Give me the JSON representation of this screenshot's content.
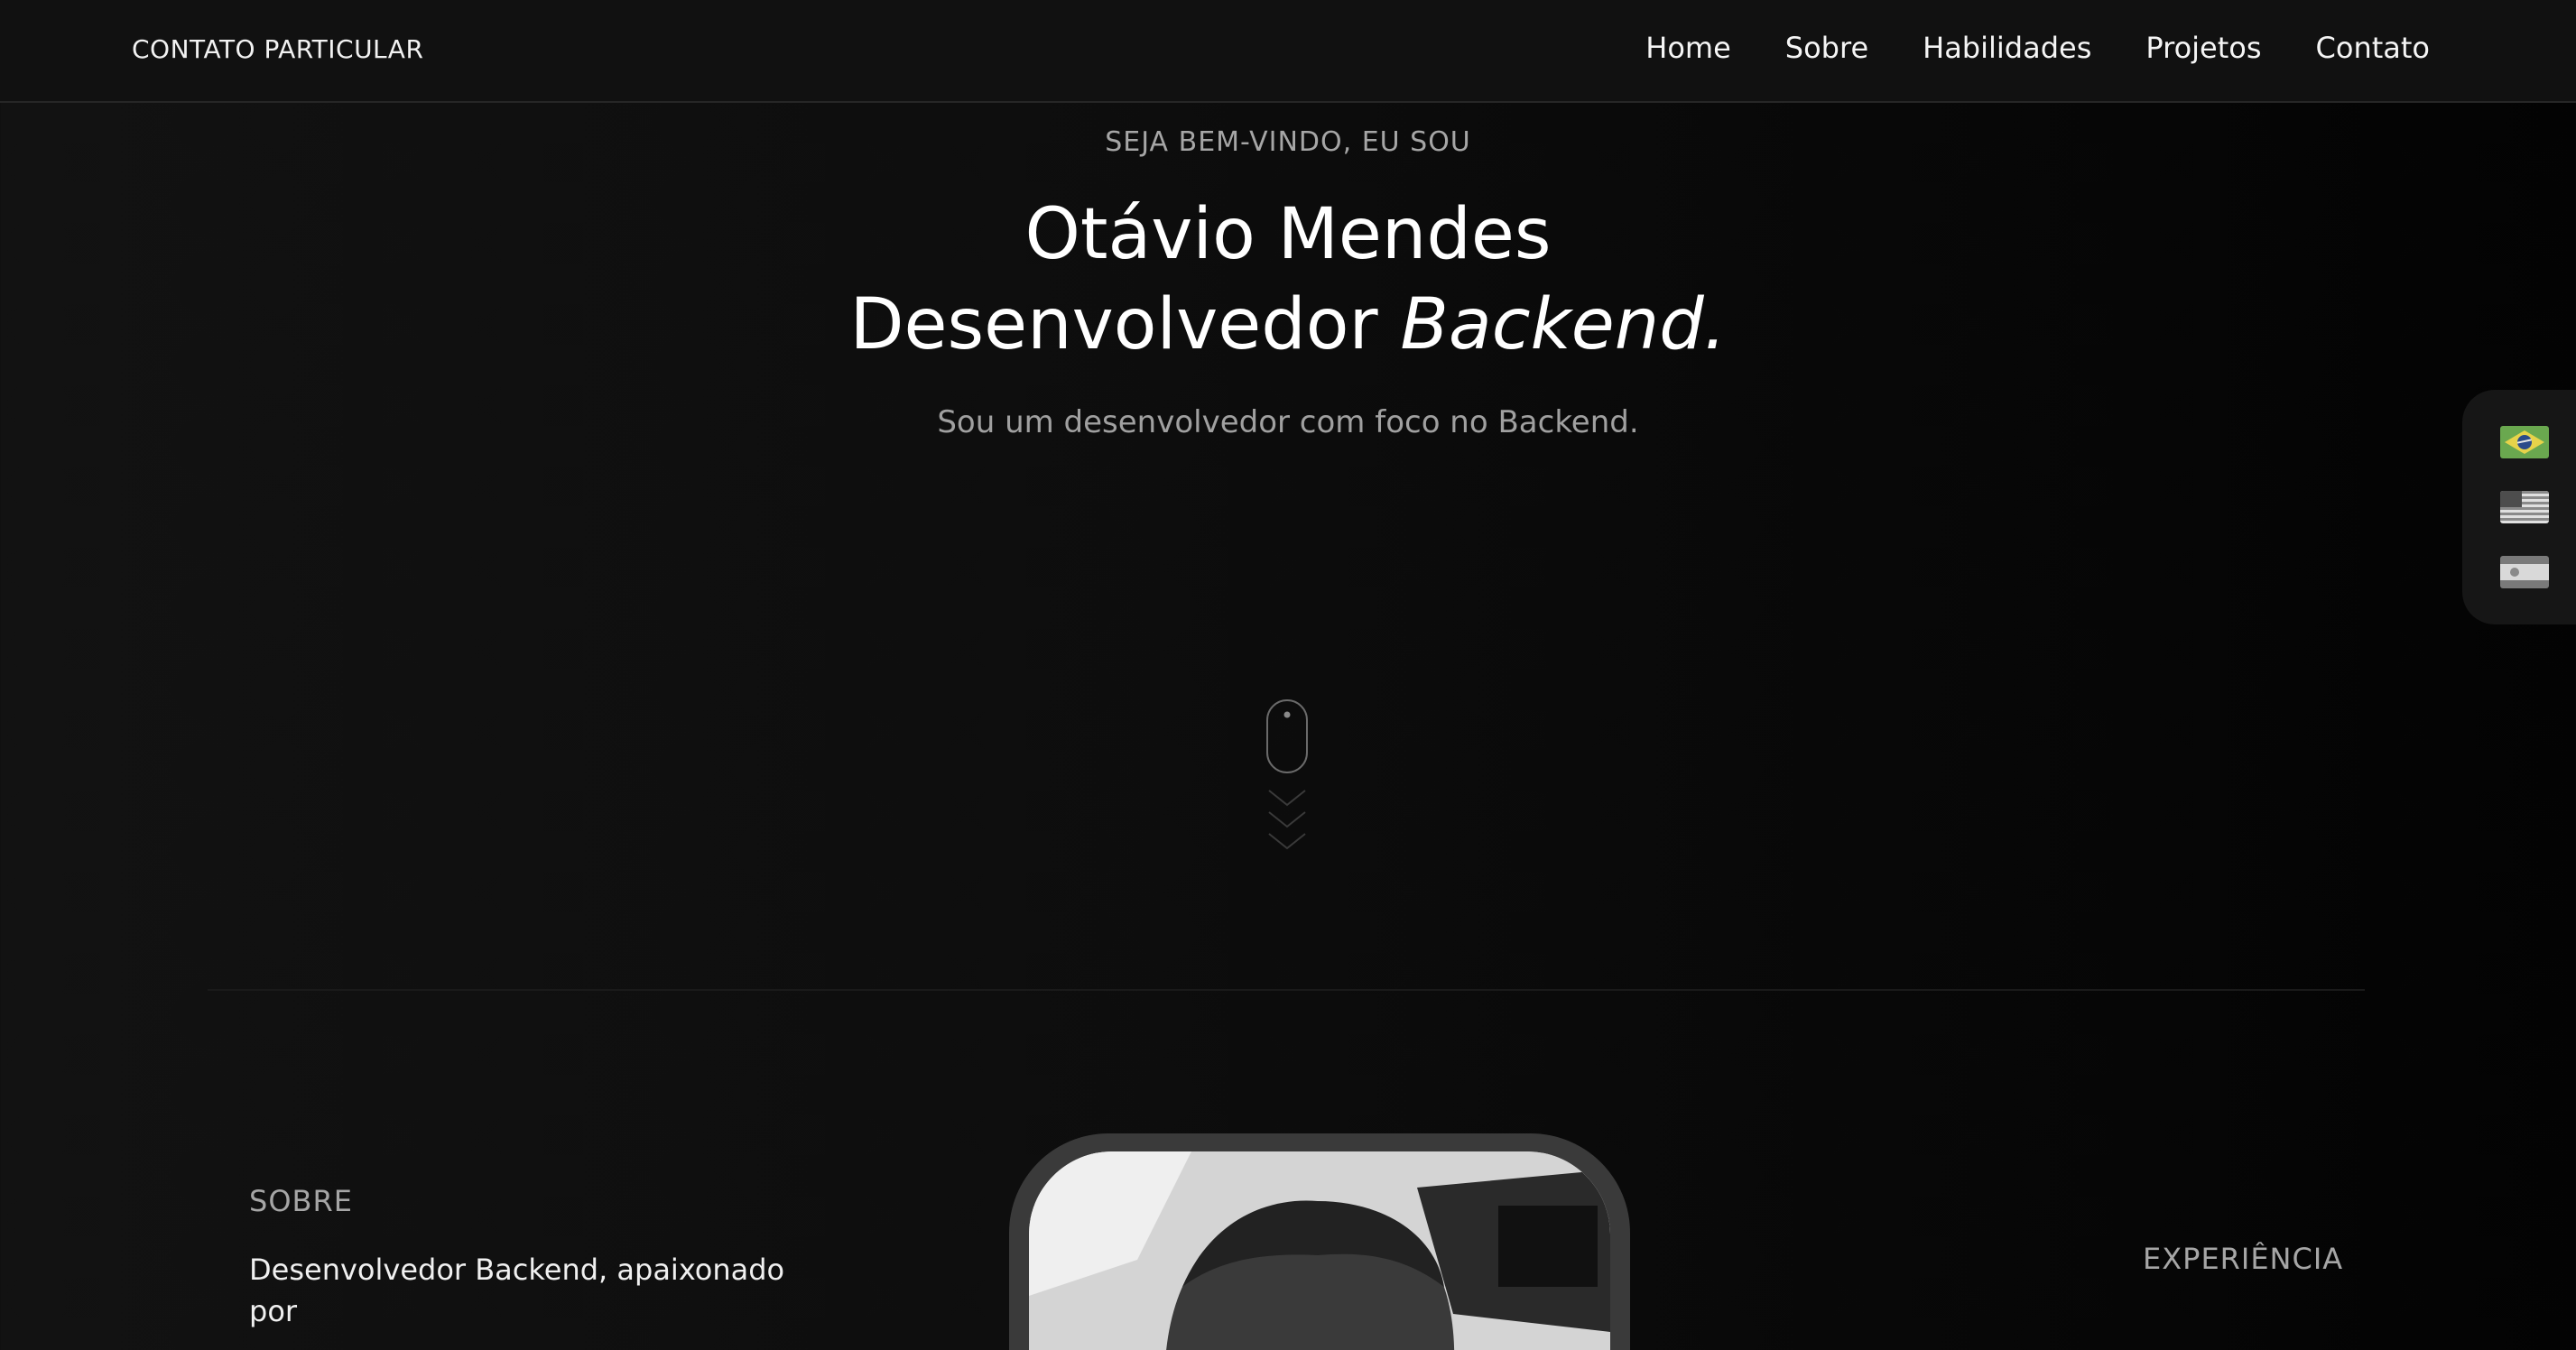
{
  "header": {
    "brand": "CONTATO PARTICULAR",
    "nav": [
      "Home",
      "Sobre",
      "Habilidades",
      "Projetos",
      "Contato"
    ]
  },
  "hero": {
    "greeting": "SEJA BEM-VINDO, EU SOU",
    "name": "Otávio Mendes",
    "role_prefix": "Desenvolvedor",
    "role_emphasis": "Backend.",
    "tagline": "Sou um desenvolvedor com foco no Backend."
  },
  "languages": {
    "icons": [
      "brazil-flag-icon",
      "usa-flag-icon",
      "spain-flag-icon"
    ]
  },
  "about": {
    "label": "SOBRE",
    "text": "Desenvolvedor Backend, apaixonado por"
  },
  "experience": {
    "label": "EXPERIÊNCIA"
  },
  "colors": {
    "background": "#0d0d0d",
    "header": "#111111",
    "muted_text": "#a6a6a6",
    "text": "#ffffff"
  }
}
